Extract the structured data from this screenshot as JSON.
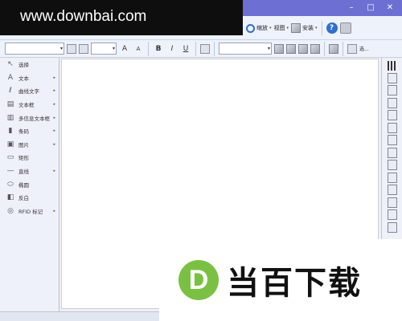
{
  "watermark": {
    "text": "www.downbai.com"
  },
  "window": {
    "controls": [
      "–",
      "□",
      "✕"
    ]
  },
  "toolbar_main": {
    "zoom_label": "缩放",
    "view_label": "视图",
    "install_label": "安装",
    "help_icon": "?"
  },
  "toolbar_format": {
    "font_name": "",
    "font_size": "",
    "bold": "B",
    "italic": "I",
    "underline": "U",
    "line_style": "",
    "grow_font": "A",
    "shrink_font": "A",
    "more_label": "选..."
  },
  "left_tools": [
    {
      "label": "选择",
      "icon": "cursor-icon",
      "glyph": "↖",
      "submenu": false
    },
    {
      "label": "文本",
      "icon": "text-icon",
      "glyph": "A",
      "submenu": true
    },
    {
      "label": "曲线文字",
      "icon": "curve-text-icon",
      "glyph": "ℓ",
      "submenu": true
    },
    {
      "label": "文本框",
      "icon": "textbox-icon",
      "glyph": "▤",
      "submenu": true
    },
    {
      "label": "多信息文本框",
      "icon": "rich-textbox-icon",
      "glyph": "▥",
      "submenu": true
    },
    {
      "label": "条码",
      "icon": "barcode-icon",
      "glyph": "▮",
      "submenu": true
    },
    {
      "label": "图片",
      "icon": "picture-icon",
      "glyph": "▣",
      "submenu": true
    },
    {
      "label": "矩形",
      "icon": "rectangle-icon",
      "glyph": "▭",
      "submenu": false
    },
    {
      "label": "直线",
      "icon": "line-icon",
      "glyph": "—",
      "submenu": true
    },
    {
      "label": "椭圆",
      "icon": "ellipse-icon",
      "glyph": "⬭",
      "submenu": false
    },
    {
      "label": "反白",
      "icon": "inverse-icon",
      "glyph": "◧",
      "submenu": false
    },
    {
      "label": "RFID 标记",
      "icon": "rfid-icon",
      "glyph": "◎",
      "submenu": true
    }
  ],
  "logo": {
    "letter": "D",
    "text": "当百下载",
    "accent": "#7ac143"
  },
  "colors": {
    "titlebar": "#6d6fd3",
    "toolbar": "#eef2fb",
    "canvas": "#ffffff"
  }
}
